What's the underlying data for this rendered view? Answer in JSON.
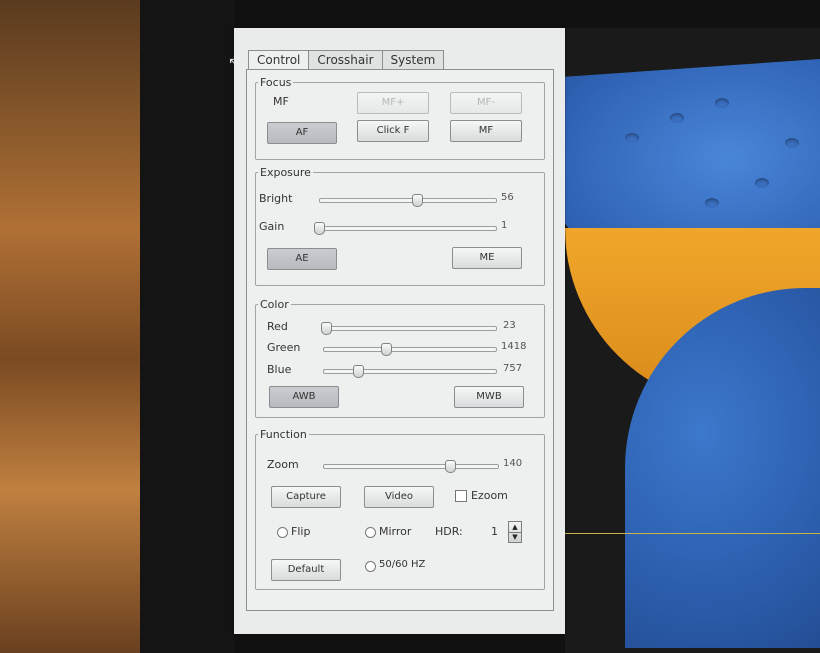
{
  "tabs": [
    "Control",
    "Crosshair",
    "System"
  ],
  "focus": {
    "legend": "Focus",
    "mode_label": "MF",
    "mf_plus": "MF+",
    "mf_minus": "MF-",
    "af": "AF",
    "click_f": "Click F",
    "mf": "MF"
  },
  "exposure": {
    "legend": "Exposure",
    "bright_label": "Bright",
    "bright_value": "56",
    "bright_level": 0.55,
    "gain_label": "Gain",
    "gain_value": "1",
    "gain_level": 0.0,
    "ae": "AE",
    "me": "ME"
  },
  "color": {
    "legend": "Color",
    "red_label": "Red",
    "red_value": "23",
    "red_level": 0.02,
    "green_label": "Green",
    "green_value": "1418",
    "green_level": 0.36,
    "blue_label": "Blue",
    "blue_value": "757",
    "blue_level": 0.2,
    "awb": "AWB",
    "mwb": "MWB"
  },
  "function": {
    "legend": "Function",
    "zoom_label": "Zoom",
    "zoom_value": "140",
    "zoom_level": 0.72,
    "capture": "Capture",
    "video": "Video",
    "ezoom": "Ezoom",
    "flip": "Flip",
    "mirror": "Mirror",
    "hdr_label": "HDR:",
    "hdr_value": "1",
    "default": "Default",
    "hz": "50/60 HZ"
  },
  "icons": {
    "cursor": "arrow-cursor-icon",
    "spin_up": "spin-up-icon",
    "spin_down": "spin-down-icon"
  }
}
